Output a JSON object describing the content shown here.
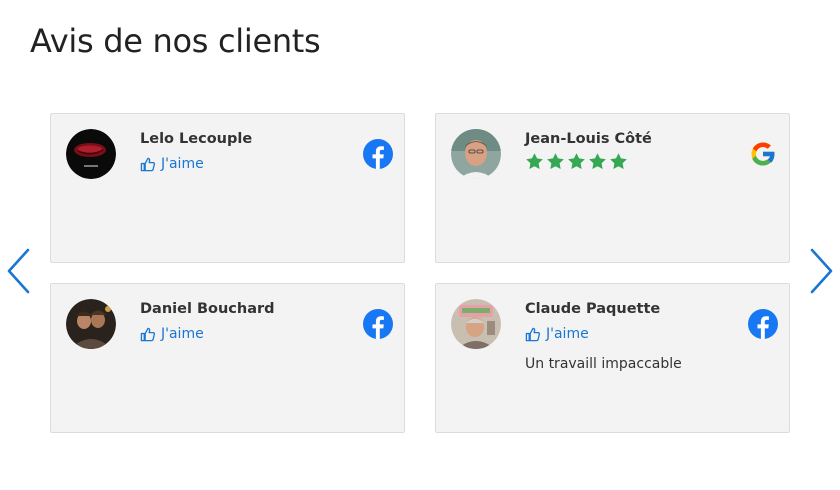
{
  "page": {
    "title": "Avis de nos clients"
  },
  "carousel": {
    "prev_icon": "chevron-left-icon",
    "next_icon": "chevron-right-icon",
    "accent_color": "#1976d2"
  },
  "reviews": [
    {
      "name": "Lelo Lecouple",
      "source": "facebook",
      "reaction_icon": "thumbs-up-icon",
      "reaction_label": "J'aime",
      "text": ""
    },
    {
      "name": "Jean-Louis Côté",
      "source": "google",
      "rating": 5,
      "text": ""
    },
    {
      "name": "Daniel Bouchard",
      "source": "facebook",
      "reaction_icon": "thumbs-up-icon",
      "reaction_label": "J'aime",
      "text": ""
    },
    {
      "name": "Claude Paquette",
      "source": "facebook",
      "reaction_icon": "thumbs-up-icon",
      "reaction_label": "J'aime",
      "text": "Un travaill impaccable"
    }
  ],
  "colors": {
    "facebook": "#1877f2",
    "star": "#34a853",
    "card_bg": "#f3f3f3"
  }
}
